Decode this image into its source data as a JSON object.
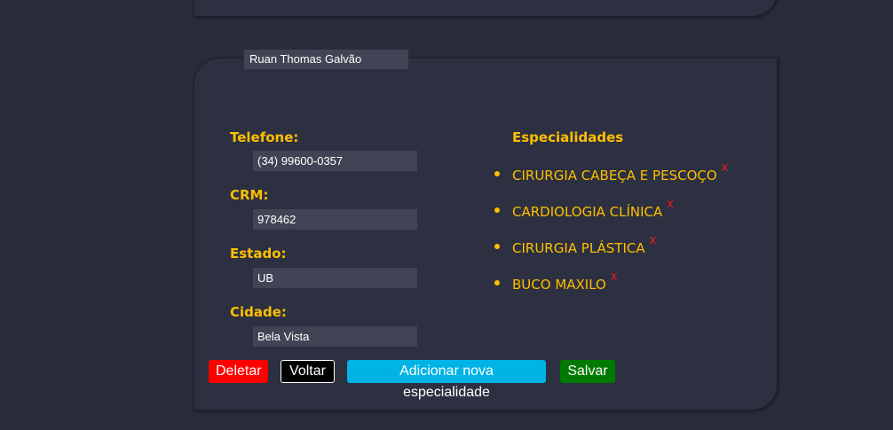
{
  "doctor": {
    "name": "Ruan Thomas Galvão"
  },
  "fields": {
    "phone": {
      "label": "Telefone:",
      "value": "(34) 99600-0357"
    },
    "crm": {
      "label": "CRM:",
      "value": "978462"
    },
    "state": {
      "label": "Estado:",
      "value": "UB"
    },
    "city": {
      "label": "Cidade:",
      "value": "Bela Vista"
    }
  },
  "specialties": {
    "title": "Especialidades",
    "remove_label": "X",
    "items": [
      {
        "name": "CIRURGIA CABEÇA E PESCOÇO"
      },
      {
        "name": "CARDIOLOGIA CLÍNICA"
      },
      {
        "name": "CIRURGIA PLÁSTICA"
      },
      {
        "name": "BUCO MAXILO"
      }
    ]
  },
  "actions": {
    "delete_label": "Deletar",
    "back_label": "Voltar",
    "add_specialty_label": "Adicionar nova especialidade",
    "save_label": "Salvar"
  },
  "colors": {
    "background": "#292d3b",
    "card": "#2c3040",
    "accent": "#ffbf00",
    "input_bg": "#414454",
    "delete": "#ff0000",
    "add": "#00b3e6",
    "save": "#007a00",
    "remove_x": "#ff1a1a"
  }
}
